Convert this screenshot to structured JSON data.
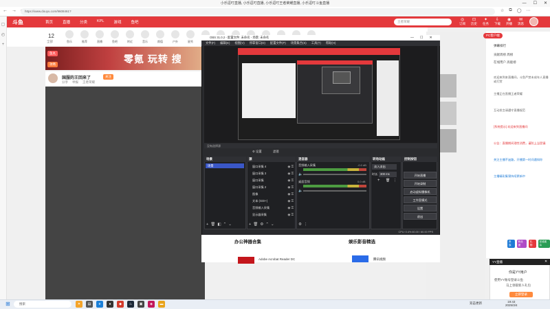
{
  "window": {
    "title": "小乐逗叮直播, 小乐逗叮直播, 小乐逗叮王者荣耀直播, 小乐逗叮斗鱼直播",
    "controls": [
      "—",
      "☐",
      "✕"
    ]
  },
  "browser": {
    "url": "https://www.douyu.com/9608461?",
    "back": "←",
    "forward": "→",
    "reload": "⟳"
  },
  "site": {
    "logo": "斗鱼",
    "nav": [
      "首页",
      "直播",
      "分类",
      "KPL",
      "游戏",
      "鱼吧"
    ],
    "search_placeholder": "王者荣耀",
    "header_icons": [
      {
        "icon": "◎",
        "label": "订阅"
      },
      {
        "icon": "⊡",
        "label": "历史"
      },
      {
        "icon": "✦",
        "label": "任务"
      },
      {
        "icon": "⇩",
        "label": "下载"
      },
      {
        "icon": "◉",
        "label": "开播"
      },
      {
        "icon": "✉",
        "label": "消息"
      }
    ]
  },
  "category": {
    "count": "12",
    "sub": "全部",
    "items": [
      "鱼乐",
      "推荐",
      "直播",
      "鱼吧",
      "附近",
      "音乐",
      "颜值",
      "户外",
      "星秀",
      "娱乐",
      "电竞",
      "手游",
      "端游",
      "单机",
      "二次元",
      "网游",
      "科技"
    ]
  },
  "banner": {
    "tag1": "鱼丸",
    "tag2": "攻略",
    "text": "零氪 玩转 搜"
  },
  "streamer": {
    "name": "国服的王回来了",
    "follow": "关注",
    "meta": [
      "分享",
      "举报",
      "王者荣耀"
    ]
  },
  "chat": {
    "pc_client": "PC客户端",
    "tabs": "弹幕排行",
    "rows": [
      "贡献周榜 周榜",
      "在线用户 高能榜"
    ],
    "messages": [
      {
        "t": "欢迎来到本直播间，斗鱼严禁未成年人直播或打赏",
        "c": ""
      },
      {
        "t": "主播正在直播王者荣耀",
        "c": ""
      },
      {
        "t": "互动发言请遵守直播规范",
        "c": ""
      },
      {
        "t": "[系统提示] 欢迎来到直播间",
        "c": "red"
      },
      {
        "t": "公告：直播期间理性消费，谨防上当受骗",
        "c": "red"
      },
      {
        "t": "关注主播不迷路，开播第一时间通知你",
        "c": "blue"
      },
      {
        "t": "主播精彩集锦持续更新中",
        "c": "blue"
      }
    ],
    "badges": [
      "贵族",
      "粉丝团",
      "礼物",
      "在线观众"
    ]
  },
  "popup": {
    "head": "YY直播",
    "title": "你是YY用户",
    "line1": "使用YY账号登录斗鱼",
    "line2": "马上领取新人礼包",
    "button": "立即登录"
  },
  "obs": {
    "title": "OBS 31.0.2 - 配置文件: 未命名 - 场景: 未命名",
    "menu": [
      "文件(F)",
      "编辑(E)",
      "视图(V)",
      "停靠窗口(D)",
      "配置文件(P)",
      "场景集合(S)",
      "工具(T)",
      "帮助(H)"
    ],
    "source_bar": "没有选择源",
    "toolbar": [
      "⚙ 设置",
      "滤镜"
    ],
    "docks": {
      "scenes": "场景",
      "sources": "源",
      "mixer": "混音器",
      "transitions": "转场动画",
      "controls": "控制按钮"
    },
    "scene_items": [
      "场景"
    ],
    "sources": [
      "窗口采集 4",
      "窗口采集 3",
      "窗口采集",
      "窗口采集 2",
      "图像",
      "文本 (GDI+)",
      "音频输入采集",
      "显示器采集"
    ],
    "mixer": [
      {
        "label": "音频输入采集",
        "db": "-0.0 dB"
      },
      {
        "label": "桌面音频",
        "db": "0.0 dB"
      }
    ],
    "transitions": {
      "select": "淡入淡出",
      "duration_label": "时长",
      "duration": "300 ms"
    },
    "controls": [
      "开始直播",
      "开始录制",
      "启动虚拟摄像机",
      "工作室模式",
      "设置",
      "退出"
    ],
    "status": "CPU: 0.4%   60.00 / 60.00 FPS"
  },
  "page_below": {
    "section1": "办公神器合集",
    "section2": "娱乐影音精选",
    "app1": "Adobe Acrobat Reader DC",
    "app2": "腾讯视频"
  },
  "taskbar": {
    "start": "⊞",
    "search": "搜索",
    "tray": "双击更新",
    "time": "19:43",
    "date": "2025/3/4"
  }
}
